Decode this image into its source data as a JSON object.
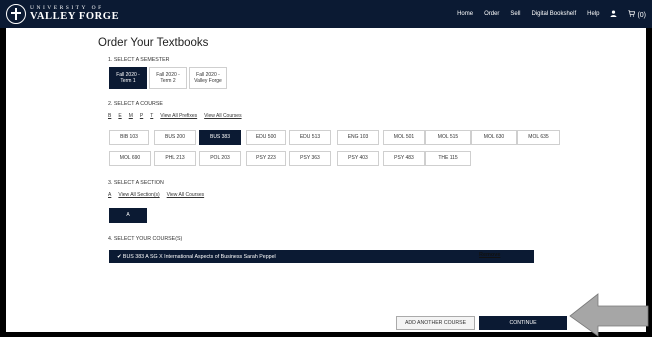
{
  "header": {
    "logo_top": "UNIVERSITY OF",
    "logo_bottom": "VALLEY FORGE",
    "nav": [
      "Home",
      "Order",
      "Sell",
      "Digital Bookshelf",
      "Help"
    ],
    "cart_count": "(0)"
  },
  "page": {
    "title": "Order Your Textbooks"
  },
  "semester": {
    "label": "1. SELECT A SEMESTER",
    "options": [
      {
        "line1": "Fall 2020 -",
        "line2": "Term 1"
      },
      {
        "line1": "Fall 2020 -",
        "line2": "Term 2"
      },
      {
        "line1": "Fall 2020 -",
        "line2": "Valley Forge"
      }
    ],
    "selected_index": 0
  },
  "course": {
    "label": "2. SELECT A COURSE",
    "prefixes": [
      "B",
      "E",
      "M",
      "P",
      "T"
    ],
    "links": [
      "View All Prefixes",
      "View All Courses"
    ],
    "options": [
      "BIB 103",
      "BUS 200",
      "BUS 383",
      "EDU 500",
      "EDU 513",
      "ENG 103",
      "MOL 501",
      "MOL 515",
      "MOL 630",
      "MOL 635",
      "MOL 690",
      "PHL 213",
      "POL 203",
      "PSY 223",
      "PSY 363",
      "PSY 403",
      "PSY 483",
      "THE 115"
    ],
    "selected": "BUS 383"
  },
  "section": {
    "label": "3. SELECT A SECTION",
    "prefix": "A",
    "links": [
      "View All Section(s)",
      "View All Courses"
    ],
    "options": [
      "A"
    ]
  },
  "your_courses": {
    "label": "4. SELECT YOUR COURSE(S)",
    "selected_text": "✔ BUS 383 A SG X International Aspects of Business Sarah Peppel",
    "remove": "Remove"
  },
  "actions": {
    "add_another": "ADD ANOTHER COURSE",
    "continue": "CONTINUE"
  },
  "colors": {
    "navy": "#0b1a33",
    "arrow": "#a6a6a6"
  }
}
